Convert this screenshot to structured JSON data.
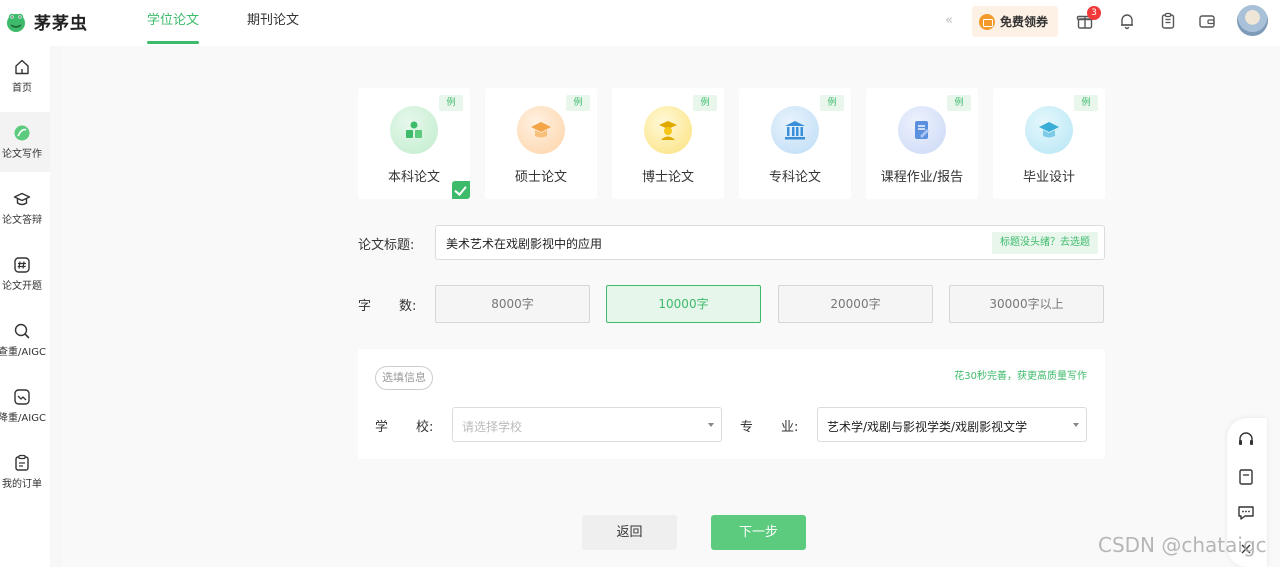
{
  "brand": {
    "name": "茅茅虫"
  },
  "topnav": {
    "tabs": [
      {
        "label": "学位论文"
      },
      {
        "label": "期刊论文"
      }
    ],
    "collapse_glyph": "«",
    "coupon_label": "免费领券",
    "gift_badge": "3",
    "icons": [
      "gift-icon",
      "bell-icon",
      "clipboard-icon",
      "wallet-icon"
    ]
  },
  "sidebar": {
    "items": [
      {
        "label": "首页",
        "icon": "home-icon"
      },
      {
        "label": "论文写作",
        "icon": "leaf-icon"
      },
      {
        "label": "论文答辩",
        "icon": "graduation-cap-icon"
      },
      {
        "label": "论文开题",
        "icon": "hash-icon"
      },
      {
        "label": "查重/AIGC",
        "icon": "search-icon"
      },
      {
        "label": "降重/AIGC",
        "icon": "reduce-icon"
      },
      {
        "label": "我的订单",
        "icon": "order-icon"
      }
    ]
  },
  "paper_types": {
    "example_tag": "例",
    "selected": "本科论文",
    "items": [
      {
        "label": "本科论文",
        "color": "#3dbb6b"
      },
      {
        "label": "硕士论文",
        "color": "#f3a548"
      },
      {
        "label": "博士论文",
        "color": "#f5c518"
      },
      {
        "label": "专科论文",
        "color": "#3a8fd8"
      },
      {
        "label": "课程作业/报告",
        "color": "#5b8fe0"
      },
      {
        "label": "毕业设计",
        "color": "#3aaed6"
      }
    ]
  },
  "title_field": {
    "label": "论文标题:",
    "value": "美术艺术在戏剧影视中的应用",
    "hint_button": "标题没头绪？去选题"
  },
  "word_count": {
    "label_a": "字",
    "label_b": "数:",
    "options": [
      "8000字",
      "10000字",
      "20000字",
      "30000字以上"
    ],
    "selected": "10000字"
  },
  "extra_info": {
    "tag": "选填信息",
    "hint": "花30秒完善，获更高质量写作",
    "school_label_a": "学",
    "school_label_b": "校:",
    "school_placeholder": "请选择学校",
    "major_label_a": "专",
    "major_label_b": "业:",
    "major_value": "艺术学/戏剧与影视学类/戏剧影视文学"
  },
  "actions": {
    "back": "返回",
    "next": "下一步"
  },
  "float_bar": {
    "icons": [
      "headset-icon",
      "notes-icon",
      "chat-icon",
      "close-icon"
    ]
  },
  "watermark": "CSDN @chataigc",
  "colors": {
    "accent": "#3dbb6b",
    "badge": "#f23a3a"
  }
}
